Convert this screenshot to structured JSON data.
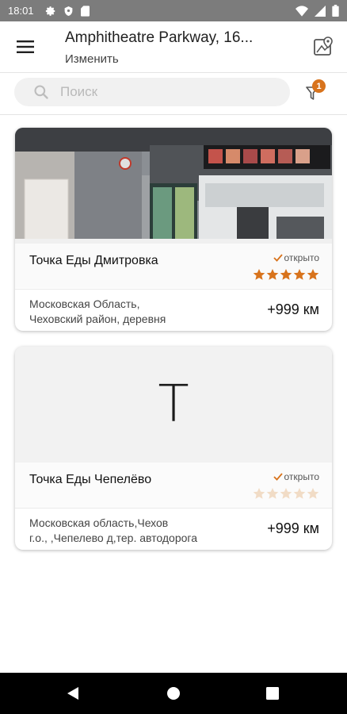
{
  "statusbar": {
    "time": "18:01",
    "icons": [
      "settings-icon",
      "shield-icon",
      "sd-card-icon",
      "wifi-icon",
      "signal-icon",
      "battery-icon"
    ]
  },
  "header": {
    "title": "Amphitheatre Parkway, 16...",
    "subtitle": "Изменить",
    "menu_icon": "hamburger-menu-icon",
    "map_icon": "map-icon"
  },
  "search": {
    "placeholder": "Поиск",
    "filter_count": "1"
  },
  "colors": {
    "accent": "#d8731c",
    "star_filled": "#d8731c",
    "star_empty": "#f1dcc6",
    "check": "#d8731c"
  },
  "places": [
    {
      "name": "Точка Еды Дмитровка",
      "status": "открыто",
      "rating": 5,
      "address_line1": "Московская Область,",
      "address_line2": "Чеховский район, деревня",
      "distance": "+999 км",
      "has_photo": true
    },
    {
      "name": "Точка Еды Чепелёво",
      "status": "открыто",
      "rating": 0,
      "placeholder_letter": "T",
      "address_line1": "Московская область,Чехов",
      "address_line2": "г.о., ,Чепелево д,тер. автодорога",
      "distance": "+999 км",
      "has_photo": false
    }
  ]
}
